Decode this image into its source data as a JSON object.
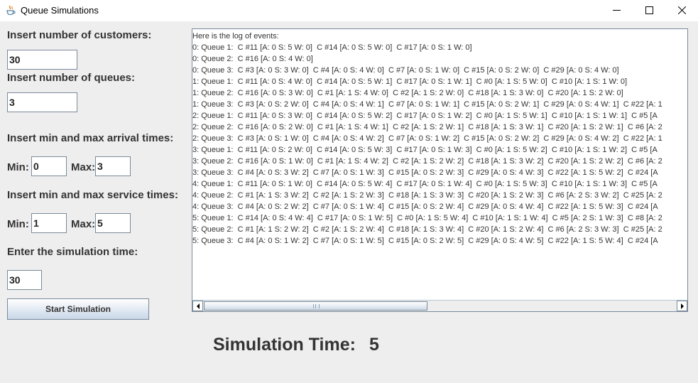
{
  "window": {
    "title": "Queue Simulations"
  },
  "form": {
    "customers_label": "Insert number of customers:",
    "customers_value": "30",
    "queues_label": "Insert number of queues:",
    "queues_value": "3",
    "arrival_label": "Insert min and max arrival times:",
    "arrival_min_label": "Min:",
    "arrival_min_value": "0",
    "arrival_max_label": "Max:",
    "arrival_max_value": "3",
    "service_label": "Insert min and max service times:",
    "service_min_label": "Min:",
    "service_min_value": "1",
    "service_max_label": "Max:",
    "service_max_value": "5",
    "simtime_label": "Enter the simulation time:",
    "simtime_value": "30",
    "start_button": "Start Simulation"
  },
  "log": {
    "lines": [
      "Here is the log of events:",
      "0: Queue 1:  C #11 [A: 0 S: 5 W: 0]  C #14 [A: 0 S: 5 W: 0]  C #17 [A: 0 S: 1 W: 0]",
      "0: Queue 2:  C #16 [A: 0 S: 4 W: 0]",
      "0: Queue 3:  C #3 [A: 0 S: 3 W: 0]  C #4 [A: 0 S: 4 W: 0]  C #7 [A: 0 S: 1 W: 0]  C #15 [A: 0 S: 2 W: 0]  C #29 [A: 0 S: 4 W: 0]",
      "1: Queue 1:  C #11 [A: 0 S: 4 W: 0]  C #14 [A: 0 S: 5 W: 1]  C #17 [A: 0 S: 1 W: 1]  C #0 [A: 1 S: 5 W: 0]  C #10 [A: 1 S: 1 W: 0]",
      "1: Queue 2:  C #16 [A: 0 S: 3 W: 0]  C #1 [A: 1 S: 4 W: 0]  C #2 [A: 1 S: 2 W: 0]  C #18 [A: 1 S: 3 W: 0]  C #20 [A: 1 S: 2 W: 0]",
      "1: Queue 3:  C #3 [A: 0 S: 2 W: 0]  C #4 [A: 0 S: 4 W: 1]  C #7 [A: 0 S: 1 W: 1]  C #15 [A: 0 S: 2 W: 1]  C #29 [A: 0 S: 4 W: 1]  C #22 [A: 1",
      "2: Queue 1:  C #11 [A: 0 S: 3 W: 0]  C #14 [A: 0 S: 5 W: 2]  C #17 [A: 0 S: 1 W: 2]  C #0 [A: 1 S: 5 W: 1]  C #10 [A: 1 S: 1 W: 1]  C #5 [A",
      "2: Queue 2:  C #16 [A: 0 S: 2 W: 0]  C #1 [A: 1 S: 4 W: 1]  C #2 [A: 1 S: 2 W: 1]  C #18 [A: 1 S: 3 W: 1]  C #20 [A: 1 S: 2 W: 1]  C #6 [A: 2",
      "2: Queue 3:  C #3 [A: 0 S: 1 W: 0]  C #4 [A: 0 S: 4 W: 2]  C #7 [A: 0 S: 1 W: 2]  C #15 [A: 0 S: 2 W: 2]  C #29 [A: 0 S: 4 W: 2]  C #22 [A: 1",
      "3: Queue 1:  C #11 [A: 0 S: 2 W: 0]  C #14 [A: 0 S: 5 W: 3]  C #17 [A: 0 S: 1 W: 3]  C #0 [A: 1 S: 5 W: 2]  C #10 [A: 1 S: 1 W: 2]  C #5 [A",
      "3: Queue 2:  C #16 [A: 0 S: 1 W: 0]  C #1 [A: 1 S: 4 W: 2]  C #2 [A: 1 S: 2 W: 2]  C #18 [A: 1 S: 3 W: 2]  C #20 [A: 1 S: 2 W: 2]  C #6 [A: 2",
      "3: Queue 3:  C #4 [A: 0 S: 3 W: 2]  C #7 [A: 0 S: 1 W: 3]  C #15 [A: 0 S: 2 W: 3]  C #29 [A: 0 S: 4 W: 3]  C #22 [A: 1 S: 5 W: 2]  C #24 [A",
      "4: Queue 1:  C #11 [A: 0 S: 1 W: 0]  C #14 [A: 0 S: 5 W: 4]  C #17 [A: 0 S: 1 W: 4]  C #0 [A: 1 S: 5 W: 3]  C #10 [A: 1 S: 1 W: 3]  C #5 [A",
      "4: Queue 2:  C #1 [A: 1 S: 3 W: 2]  C #2 [A: 1 S: 2 W: 3]  C #18 [A: 1 S: 3 W: 3]  C #20 [A: 1 S: 2 W: 3]  C #6 [A: 2 S: 3 W: 2]  C #25 [A: 2",
      "4: Queue 3:  C #4 [A: 0 S: 2 W: 2]  C #7 [A: 0 S: 1 W: 4]  C #15 [A: 0 S: 2 W: 4]  C #29 [A: 0 S: 4 W: 4]  C #22 [A: 1 S: 5 W: 3]  C #24 [A",
      "5: Queue 1:  C #14 [A: 0 S: 4 W: 4]  C #17 [A: 0 S: 1 W: 5]  C #0 [A: 1 S: 5 W: 4]  C #10 [A: 1 S: 1 W: 4]  C #5 [A: 2 S: 1 W: 3]  C #8 [A: 2",
      "5: Queue 2:  C #1 [A: 1 S: 2 W: 2]  C #2 [A: 1 S: 2 W: 4]  C #18 [A: 1 S: 3 W: 4]  C #20 [A: 1 S: 2 W: 4]  C #6 [A: 2 S: 3 W: 3]  C #25 [A: 2",
      "5: Queue 3:  C #4 [A: 0 S: 1 W: 2]  C #7 [A: 0 S: 1 W: 5]  C #15 [A: 0 S: 2 W: 5]  C #29 [A: 0 S: 4 W: 5]  C #22 [A: 1 S: 5 W: 4]  C #24 [A"
    ]
  },
  "status": {
    "label": "Simulation Time:",
    "value": "5"
  },
  "icons": {
    "app": "java-cup-icon",
    "minimize": "minimize-icon",
    "maximize": "maximize-icon",
    "close": "close-icon"
  }
}
